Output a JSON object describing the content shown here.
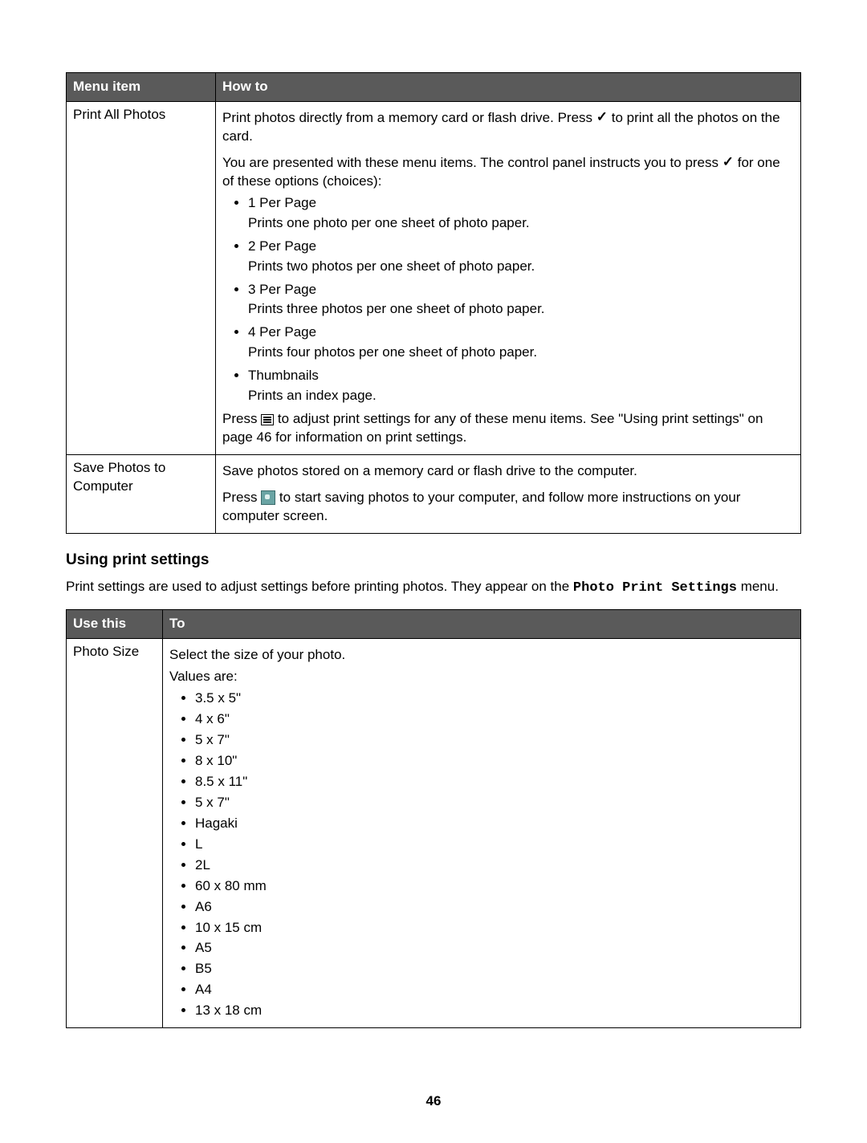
{
  "table1": {
    "headers": {
      "c1": "Menu item",
      "c2": "How to"
    },
    "row1": {
      "label": "Print All Photos",
      "para1a": "Print photos directly from a memory card or flash drive. Press ",
      "para1b": " to print all the photos on the card.",
      "para2a": "You are presented with these menu items. The control panel instructs you to press ",
      "para2b": " for one of these options (choices):",
      "opts": [
        {
          "t": "1 Per Page",
          "d": "Prints one photo per one sheet of photo paper."
        },
        {
          "t": "2 Per Page",
          "d": "Prints two photos per one sheet of photo paper."
        },
        {
          "t": "3 Per Page",
          "d": "Prints three photos per one sheet of photo paper."
        },
        {
          "t": "4 Per Page",
          "d": "Prints four photos per one sheet of photo paper."
        },
        {
          "t": "Thumbnails",
          "d": "Prints an index page."
        }
      ],
      "para3a": "Press ",
      "para3b": " to adjust print settings for any of these menu items. See \"Using print settings\" on page 46 for information on print settings."
    },
    "row2": {
      "label": "Save Photos to Computer",
      "para1": "Save photos stored on a memory card or flash drive to the computer.",
      "para2a": "Press ",
      "para2b": " to start saving photos to your computer, and follow more instructions on your computer screen."
    }
  },
  "section": {
    "heading": "Using print settings",
    "intro_a": "Print settings are used to adjust settings before printing photos. They appear on the ",
    "intro_mono": "Photo Print Settings",
    "intro_b": " menu."
  },
  "table2": {
    "headers": {
      "c1": "Use this",
      "c2": "To"
    },
    "row1": {
      "label": "Photo Size",
      "lead": "Select the size of your photo.",
      "values_label": "Values are:",
      "values": [
        "3.5 x 5\"",
        "4 x 6\"",
        "5 x 7\"",
        "8 x 10\"",
        "8.5 x 11\"",
        "5 x 7\"",
        "Hagaki",
        "L",
        "2L",
        "60 x 80 mm",
        "A6",
        "10 x 15 cm",
        "A5",
        "B5",
        "A4",
        "13 x 18 cm"
      ]
    }
  },
  "page_number": "46",
  "icons": {
    "check": "✓"
  }
}
